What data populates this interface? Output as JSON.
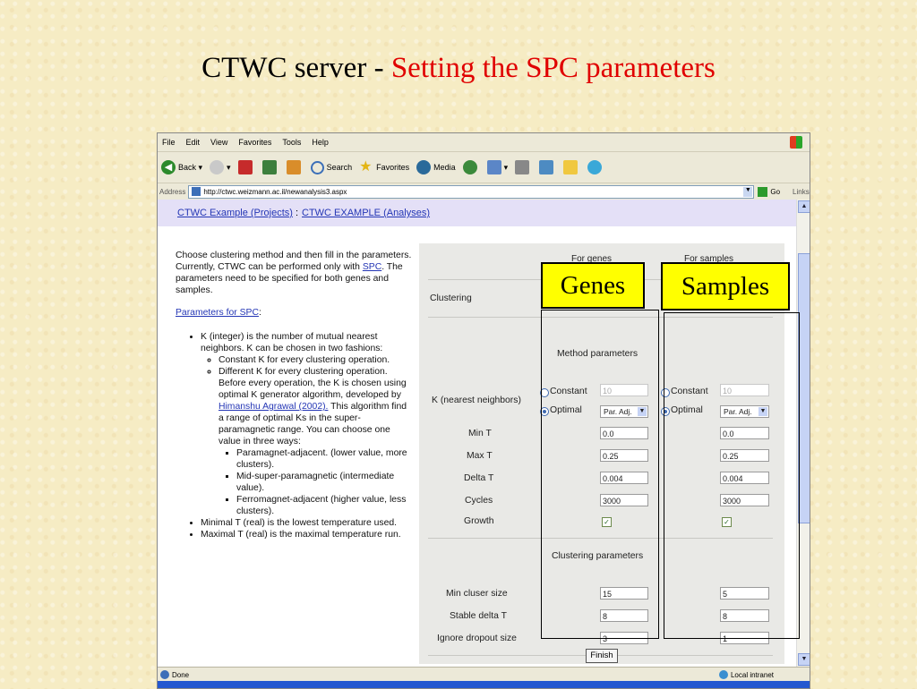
{
  "slide": {
    "title_prefix": "CTWC server - ",
    "title_highlight": "Setting the SPC parameters"
  },
  "browser": {
    "menu": [
      "File",
      "Edit",
      "View",
      "Favorites",
      "Tools",
      "Help"
    ],
    "toolbar": {
      "back": "Back",
      "search": "Search",
      "favorites": "Favorites",
      "media": "Media"
    },
    "address_label": "Address",
    "url": "http://ctwc.weizmann.ac.il/newanalysis3.aspx",
    "go": "Go",
    "links": "Links",
    "status": {
      "left": "Done",
      "zone": "Local intranet"
    }
  },
  "page": {
    "breadcrumb": {
      "projects": "CTWC Example (Projects)",
      "sep": " : ",
      "analyses": "CTWC EXAMPLE (Analyses)"
    },
    "intro_1": "Choose clustering method and then fill in the parameters.",
    "intro_2a": "Currently, CTWC can be performed only with ",
    "intro_2_link": "SPC",
    "intro_2b": ". The parameters need to be specified for both genes and samples.",
    "params_link": "Parameters for SPC",
    "params_colon": ":",
    "bullet_k": "K (integer) is the number of mutual nearest neighbors. K can be chosen in two fashions:",
    "sub_const": "Constant K for every clustering operation.",
    "sub_diff_a": "Different K for every clustering operation. Before every operation, the K is chosen using optimal K generator algorithm, developed by ",
    "sub_diff_link": "Himanshu Agrawal (2002).",
    "sub_diff_b": " This algorithm find a range of optimal Ks in the super-paramagnetic range. You can choose one value in three ways:",
    "way_1": "Paramagnet-adjacent. (lower value, more clusters).",
    "way_2": "Mid-super-paramagnetic (intermediate value).",
    "way_3": "Ferromagnet-adjacent (higher value, less clusters).",
    "bullet_min": "Minimal T (real) is the lowest temperature used.",
    "bullet_max": "Maximal T (real) is the maximal temperature run."
  },
  "form": {
    "head_genes": "For genes",
    "head_samples": "For samples",
    "clustering_label": "Clustering",
    "method_params": "Method parameters",
    "k_label": "K (nearest neighbors)",
    "constant": "Constant",
    "optimal": "Optimal",
    "mint": "Min T",
    "maxt": "Max T",
    "deltat": "Delta T",
    "cycles": "Cycles",
    "growth": "Growth",
    "clustering_params": "Clustering parameters",
    "min_cluster": "Min cluser size",
    "stable_delta": "Stable delta T",
    "ignore_dropout": "Ignore dropout size",
    "finish": "Finish",
    "genes": {
      "k_const": "10",
      "k_opt": "Par. Adj.",
      "mint": "0.0",
      "maxt": "0.25",
      "deltat": "0.004",
      "cycles": "3000",
      "growth": true,
      "min_cluster": "15",
      "stable_delta": "8",
      "ignore_dropout": "3"
    },
    "samples": {
      "k_const": "10",
      "k_opt": "Par. Adj.",
      "mint": "0.0",
      "maxt": "0.25",
      "deltat": "0.004",
      "cycles": "3000",
      "growth": true,
      "min_cluster": "5",
      "stable_delta": "8",
      "ignore_dropout": "1"
    }
  },
  "callouts": {
    "genes": "Genes",
    "samples": "Samples"
  }
}
